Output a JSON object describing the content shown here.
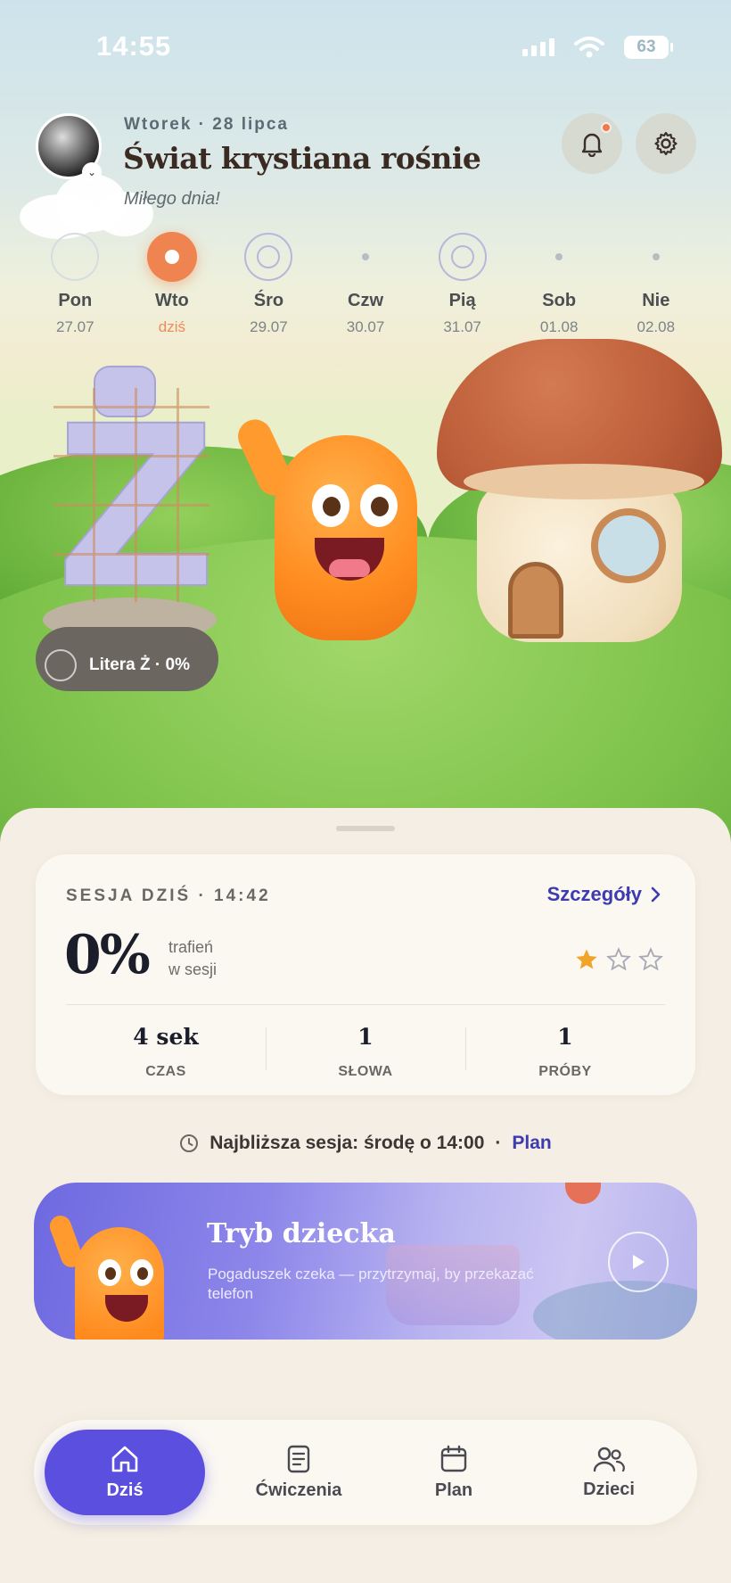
{
  "status_bar": {
    "time": "14:55",
    "battery": "63"
  },
  "header": {
    "date": "Wtorek · 28 lipca",
    "title": "Świat krystiana rośnie",
    "subtitle": "Miłego dnia!"
  },
  "week": [
    {
      "name": "Pon",
      "date": "27.07",
      "state": "faint-ring"
    },
    {
      "name": "Wto",
      "date": "dziś",
      "state": "today"
    },
    {
      "name": "Śro",
      "date": "29.07",
      "state": "ring"
    },
    {
      "name": "Czw",
      "date": "30.07",
      "state": "dot"
    },
    {
      "name": "Pią",
      "date": "31.07",
      "state": "ring"
    },
    {
      "name": "Sob",
      "date": "01.08",
      "state": "dot"
    },
    {
      "name": "Nie",
      "date": "02.08",
      "state": "dot"
    }
  ],
  "scene": {
    "letter": "Z",
    "letter_chip": "Litera Ż · 0%"
  },
  "session": {
    "label": "SESJA DZIŚ · 14:42",
    "details_link": "Szczegóły",
    "percent": "0%",
    "percent_caption_1": "trafień",
    "percent_caption_2": "w sesji",
    "stars_filled": 1,
    "stars_total": 3,
    "stats": [
      {
        "value": "4 sek",
        "label": "CZAS"
      },
      {
        "value": "1",
        "label": "SŁOWA"
      },
      {
        "value": "1",
        "label": "PRÓBY"
      }
    ]
  },
  "next_session": {
    "text": "Najbliższa sesja: środę o 14:00",
    "separator": "·",
    "plan_link": "Plan"
  },
  "kid_mode": {
    "title": "Tryb dziecka",
    "subtitle": "Pogaduszek czeka — przytrzymaj, by przekazać telefon"
  },
  "nav": [
    {
      "label": "Dziś",
      "icon": "home-icon",
      "active": true
    },
    {
      "label": "Ćwiczenia",
      "icon": "document-icon",
      "active": false
    },
    {
      "label": "Plan",
      "icon": "calendar-icon",
      "active": false
    },
    {
      "label": "Dzieci",
      "icon": "users-icon",
      "active": false
    }
  ],
  "colors": {
    "accent": "#5b4fe0",
    "today": "#f08450",
    "link": "#3e3ab0",
    "star": "#f0a52a"
  }
}
